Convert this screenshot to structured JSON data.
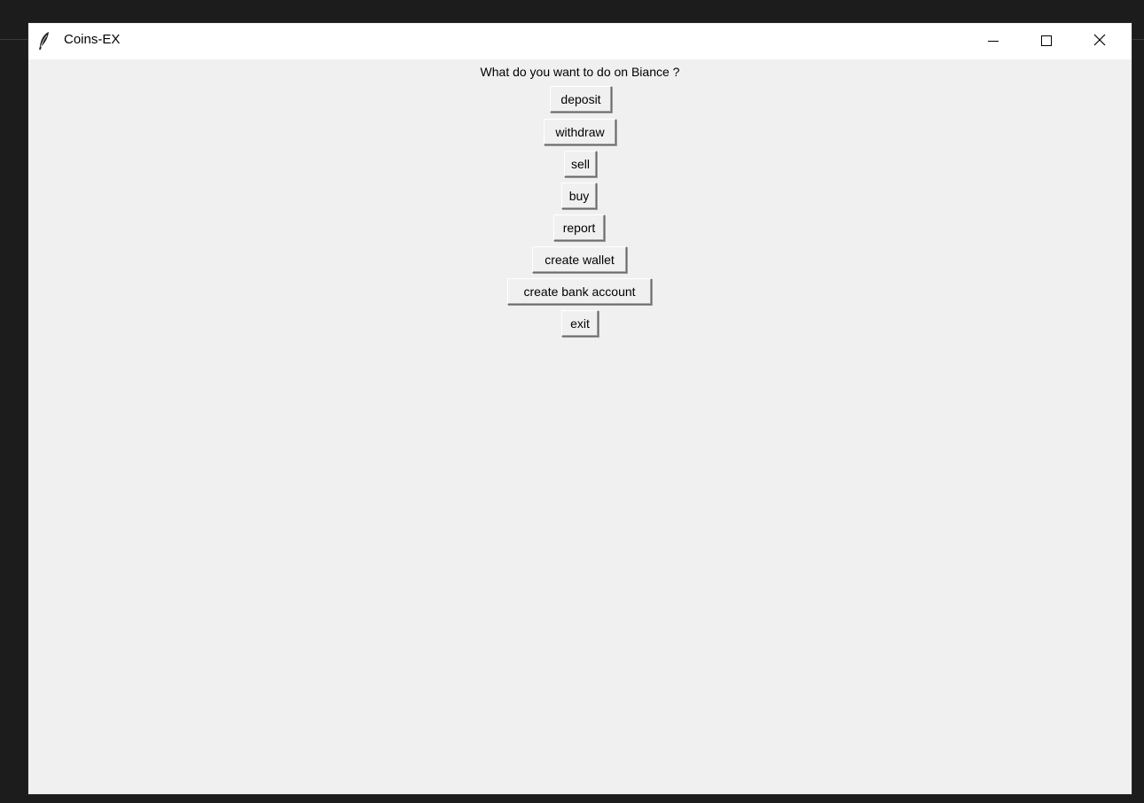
{
  "window": {
    "title": "Coins-EX",
    "icon": "feather-icon"
  },
  "controls": {
    "minimize_icon": "minimize-icon",
    "maximize_icon": "maximize-icon",
    "close_icon": "close-icon"
  },
  "main": {
    "prompt": "What do you want to do on Biance ?",
    "buttons": [
      "deposit",
      "withdraw",
      "sell",
      "buy",
      "report",
      "create wallet",
      "create bank account",
      "exit"
    ]
  }
}
